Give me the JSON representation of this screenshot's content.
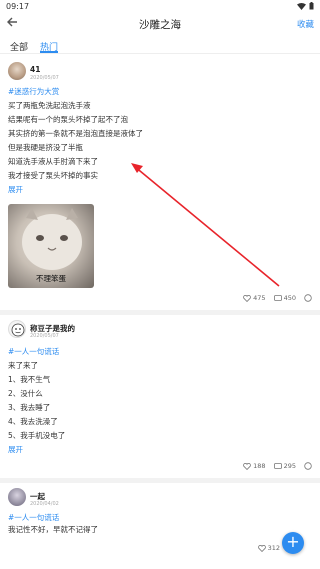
{
  "status_bar": {
    "time": "09:17"
  },
  "nav": {
    "back_icon": "arrow-left-icon",
    "title": "沙雕之海",
    "collect": "收藏"
  },
  "tabs": [
    {
      "label": "全部"
    },
    {
      "label": "热门"
    }
  ],
  "posts": [
    {
      "user": "41",
      "date": "2020/05/07",
      "topic": "#迷惑行为大赏",
      "lines": [
        "买了两瓶免洗起泡洗手液",
        "结果呢有一个的泵头坏掉了起不了泡",
        "其实挤的第一条就不是泡泡直接是液体了",
        "但是我硬是挤没了半瓶",
        "知道洗手液从手肘滴下来了",
        "我才接受了泵头坏掉的事实"
      ],
      "expand": "展开",
      "image_caption": "不理笨蛋",
      "likes": "475",
      "comments": "450"
    },
    {
      "user": "称豆子是我的",
      "date": "2020/05/07",
      "topic": "#一人一句谎话",
      "lines": [
        "来了来了",
        "1、我不生气",
        "2、没什么",
        "3、我去睡了",
        "4、我去洗澡了",
        "5、我手机没电了"
      ],
      "expand": "展开",
      "likes": "188",
      "comments": "295"
    },
    {
      "user": "一起",
      "date": "2020/04/02",
      "topic": "#一人一句谎话",
      "lines": [
        "我记性不好，早就不记得了"
      ],
      "likes": "312"
    }
  ],
  "fab": {
    "label": "+"
  },
  "colors": {
    "accent": "#2d8cf0",
    "annotation_arrow": "#e8242b"
  }
}
